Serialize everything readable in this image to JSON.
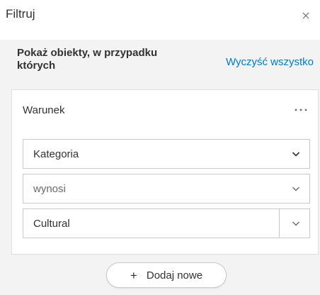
{
  "header": {
    "title": "Filtruj",
    "close_icon": "close-icon"
  },
  "subheader": {
    "title": "Pokaż obiekty, w przypadku których",
    "clear_all_label": "Wyczyść wszystko"
  },
  "condition": {
    "title": "Warunek",
    "more_icon": "more-horizontal-icon",
    "field_value": "Kategoria",
    "operator_value": "wynosi",
    "value_value": "Cultural"
  },
  "footer": {
    "add_new_label": "Dodaj nowe",
    "add_icon": "plus-icon"
  },
  "colors": {
    "accent": "#007ac2",
    "panel_bg": "#f3f3f3",
    "text": "#323232",
    "border": "#c9c9c9"
  }
}
